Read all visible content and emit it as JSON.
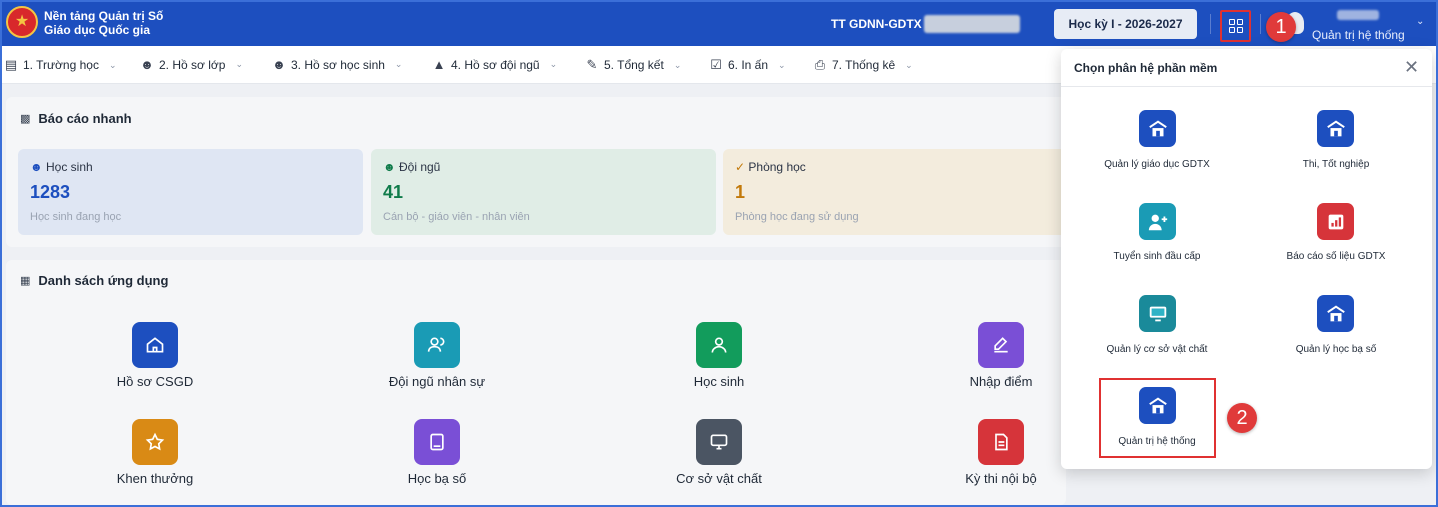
{
  "header": {
    "brand_line1": "Nền tảng Quản trị Số",
    "brand_line2": "Giáo dục Quốc gia",
    "center_name": "TT GDNN-GDTX I",
    "term": "Học kỳ I - 2026-2027",
    "user_role": "Quản trị hệ thống",
    "step1": "1",
    "step2": "2"
  },
  "nav": {
    "items": [
      {
        "label": "1. Trường học",
        "icon": "building-icon"
      },
      {
        "label": "2. Hồ sơ lớp",
        "icon": "user-icon"
      },
      {
        "label": "3. Hồ sơ học sinh",
        "icon": "users-icon"
      },
      {
        "label": "4. Hồ sơ đội ngũ",
        "icon": "graduation-cap-icon"
      },
      {
        "label": "5. Tổng kết",
        "icon": "pencil-icon"
      },
      {
        "label": "6. In ấn",
        "icon": "checkbox-icon"
      },
      {
        "label": "7. Thống kê",
        "icon": "printer-icon"
      }
    ]
  },
  "quick_report": {
    "title": "Báo cáo nhanh",
    "cards": [
      {
        "label": "Học sinh",
        "value": "1283",
        "desc": "Học sinh đang học",
        "color": "#1d4fbf",
        "bg": "#dfe6f3"
      },
      {
        "label": "Đội ngũ",
        "value": "41",
        "desc": "Cán bộ - giáo viên - nhân viên",
        "color": "#0f7b4a",
        "bg": "#e0ede6"
      },
      {
        "label": "Phòng học",
        "value": "1",
        "desc": "Phòng học đang sử dụng",
        "color": "#c2790a",
        "bg": "#f3ecdd"
      }
    ]
  },
  "apps": {
    "title": "Danh sách ứng dụng",
    "items": [
      {
        "label": "Hồ sơ CSGD",
        "color": "#1d4fbf",
        "icon": "home-icon"
      },
      {
        "label": "Đội ngũ nhân sự",
        "color": "#1a9bb5",
        "icon": "users-icon"
      },
      {
        "label": "Học sinh",
        "color": "#129c5c",
        "icon": "user-icon"
      },
      {
        "label": "Nhập điểm",
        "color": "#7a4fd6",
        "icon": "edit-icon"
      },
      {
        "label": "Khen thưởng",
        "color": "#d98a15",
        "icon": "star-icon"
      },
      {
        "label": "Học bạ số",
        "color": "#7a4fd6",
        "icon": "book-icon"
      },
      {
        "label": "Cơ sở vật chất",
        "color": "#4b5563",
        "icon": "monitor-icon"
      },
      {
        "label": "Kỳ thi nội bộ",
        "color": "#d6343a",
        "icon": "document-icon"
      }
    ]
  },
  "popup": {
    "title": "Chọn phân hệ phần mềm",
    "items": [
      {
        "label": "Quản lý giáo dục GDTX",
        "color": "#1d4fbf",
        "icon": "school-icon"
      },
      {
        "label": "Thi, Tốt nghiệp",
        "color": "#1d4fbf",
        "icon": "school-icon"
      },
      {
        "label": "Tuyển sinh đầu cấp",
        "color": "#1a9bb5",
        "icon": "user-plus-icon"
      },
      {
        "label": "Báo cáo số liệu GDTX",
        "color": "#d6343a",
        "icon": "bar-chart-icon"
      },
      {
        "label": "Quản lý cơ sở vật chất",
        "color": "#1a8a9a",
        "icon": "monitor-icon"
      },
      {
        "label": "Quản lý học bạ số",
        "color": "#1d4fbf",
        "icon": "school-icon"
      },
      {
        "label": "Quản trị hệ thống",
        "color": "#1d4fbf",
        "icon": "school-icon"
      }
    ]
  }
}
